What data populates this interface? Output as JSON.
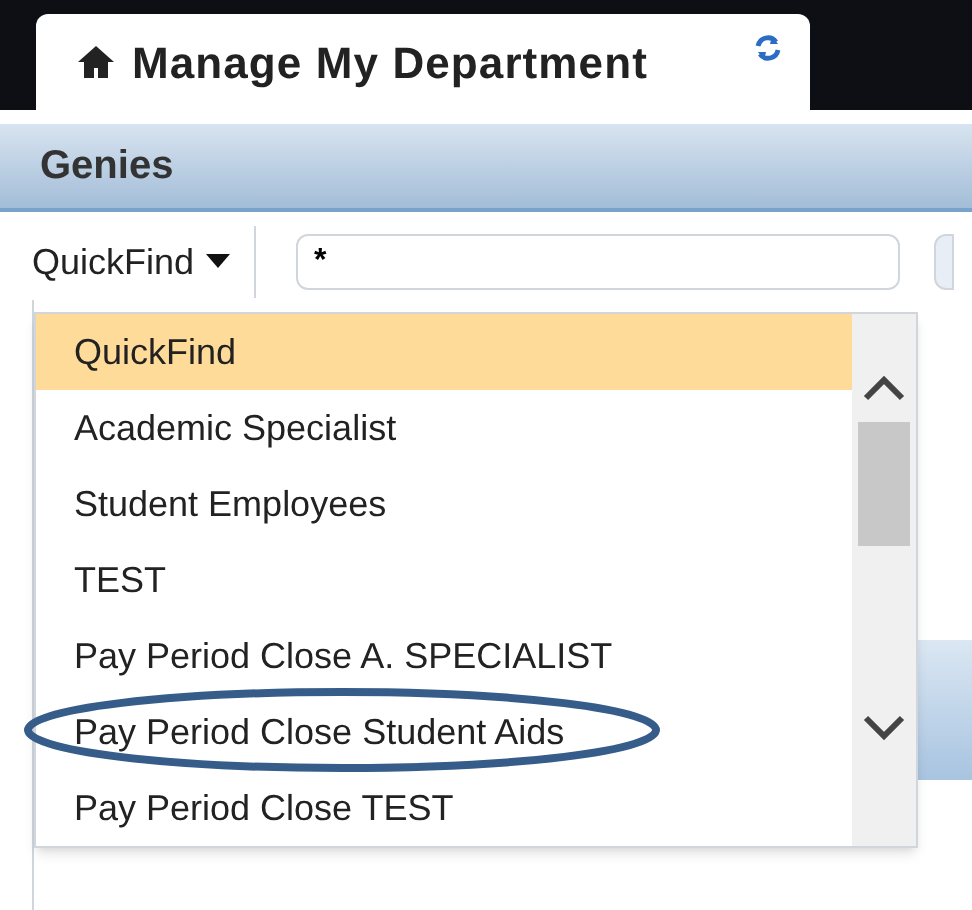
{
  "tab": {
    "title": "Manage My Department",
    "selected": true
  },
  "panel": {
    "title": "Genies"
  },
  "search": {
    "mode": "QuickFind",
    "value": "*"
  },
  "menu": {
    "items": [
      {
        "label": "QuickFind",
        "selected": true,
        "circled": false
      },
      {
        "label": "Academic Specialist",
        "selected": false,
        "circled": false
      },
      {
        "label": "Student Employees",
        "selected": false,
        "circled": false
      },
      {
        "label": "TEST",
        "selected": false,
        "circled": false
      },
      {
        "label": "Pay Period Close A. SPECIALIST",
        "selected": false,
        "circled": false
      },
      {
        "label": "Pay Period Close Student Aids",
        "selected": false,
        "circled": true
      },
      {
        "label": "Pay Period Close TEST",
        "selected": false,
        "circled": false
      }
    ]
  }
}
